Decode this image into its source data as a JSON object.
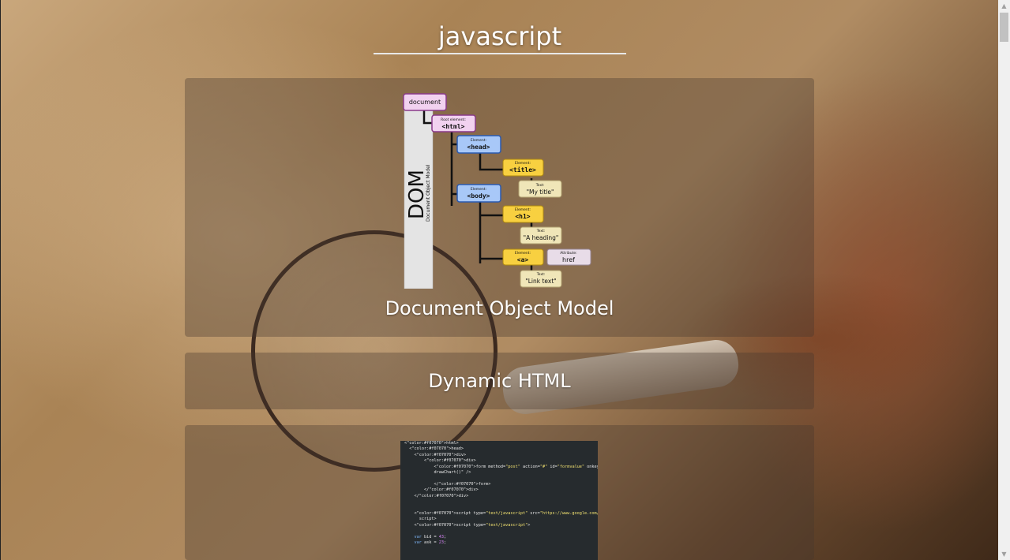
{
  "page": {
    "title": "javascript"
  },
  "cards": [
    {
      "title": "Document Object Model",
      "image": {
        "dom_label": "DOM",
        "dom_sublabel": "Document Object Model",
        "nodes": {
          "document": "document",
          "html_caption": "Root element:",
          "html": "<html>",
          "head_caption": "Element:",
          "head": "<head>",
          "title_caption": "Element:",
          "title": "<title>",
          "title_text_caption": "Text:",
          "title_text": "\"My title\"",
          "body_caption": "Element:",
          "body": "<body>",
          "h1_caption": "Element:",
          "h1": "<h1>",
          "h1_text_caption": "Text:",
          "h1_text": "\"A heading\"",
          "a_caption": "Element:",
          "a": "<a>",
          "attr_caption": "Attribute:",
          "attr": "href",
          "a_text_caption": "Text:",
          "a_text": "\"Link text\""
        }
      }
    },
    {
      "title": "Dynamic HTML"
    },
    {
      "code_lines": [
        "<html>",
        "  <head>",
        "    <div>",
        "        <div>",
        "            <form method=\"post\" action=\"#\" id=\"formvalue\" onkeyup=\"",
        "            drawChart()\" />",
        "",
        "            </form>",
        "        </div>",
        "    </div>",
        "",
        "",
        "    <script type=\"text/javascript\" src=\"https://www.google.com/jsapi\"></",
        "      script>",
        "    <script type=\"text/javascript\">",
        "",
        "    var bid = 43;",
        "    var ask = 23;"
      ]
    }
  ],
  "scrollbar": {
    "up_icon": "▲",
    "down_icon": "▼"
  },
  "colors": {
    "card_bg": "rgba(70,55,45,0.35)",
    "title": "#ffffff",
    "dom_pink": "#f2d2f0",
    "dom_blue": "#a8c8f8",
    "dom_yellow": "#f8d040",
    "dom_cream": "#f0e6b8"
  }
}
